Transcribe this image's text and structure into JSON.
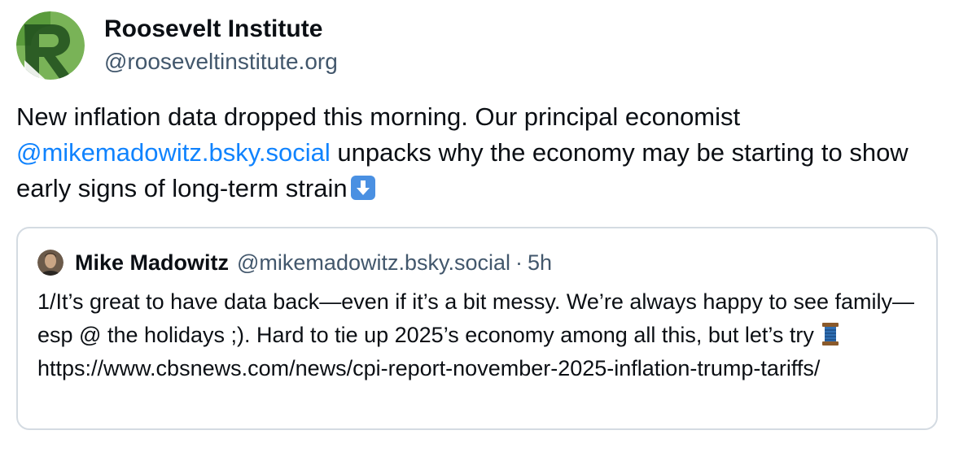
{
  "post": {
    "author": {
      "display_name": "Roosevelt Institute",
      "handle": "@rooseveltinstitute.org",
      "avatar_icon": "roosevelt-r-logo-icon"
    },
    "text_before_mention": "New inflation data dropped this morning. Our principal economist ",
    "mention": "@mikemadowitz.bsky.social",
    "text_after_mention": " unpacks why the economy may be starting to show early signs of long-term strain",
    "emoji": "down-arrow-emoji-icon"
  },
  "quote": {
    "author": {
      "display_name": "Mike Madowitz",
      "handle": "@mikemadowitz.bsky.social",
      "separator": "·",
      "time": "5h",
      "avatar_icon": "profile-photo-icon"
    },
    "text_before_emoji": "1/It’s great to have data back—even if it’s a bit messy. We’re always happy to see family—esp @ the holidays ;). Hard to tie up 2025’s economy among all this, but let’s try ",
    "emoji": "spool-of-thread-icon",
    "text_after_emoji": "https://www.cbsnews.com/news/cpi-report-november-2025-inflation-trump-tariffs/"
  },
  "colors": {
    "link": "#1083fe",
    "secondary_text": "#42576c",
    "card_border": "#d4dbe2",
    "logo_green_light": "#6aa84f",
    "logo_green_dark": "#2f6b2a"
  }
}
